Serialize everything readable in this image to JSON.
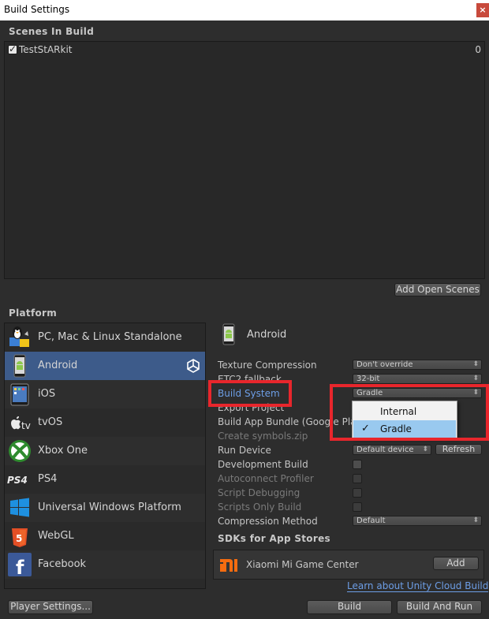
{
  "window": {
    "title": "Build Settings",
    "close": "×"
  },
  "scenes": {
    "header": "Scenes In Build",
    "items": [
      {
        "name": "TestStARkit",
        "index": "0",
        "checked": true
      }
    ],
    "add_open_scenes": "Add Open Scenes"
  },
  "platform": {
    "header": "Platform",
    "items": [
      {
        "label": "PC, Mac & Linux Standalone",
        "icon": "pc-mac-linux-icon"
      },
      {
        "label": "Android",
        "icon": "android-icon",
        "selected": true
      },
      {
        "label": "iOS",
        "icon": "ios-icon"
      },
      {
        "label": "tvOS",
        "icon": "tvos-icon"
      },
      {
        "label": "Xbox One",
        "icon": "xbox-icon"
      },
      {
        "label": "PS4",
        "icon": "ps4-icon"
      },
      {
        "label": "Universal Windows Platform",
        "icon": "windows-icon"
      },
      {
        "label": "WebGL",
        "icon": "html5-icon"
      },
      {
        "label": "Facebook",
        "icon": "facebook-icon"
      }
    ],
    "selected_title": "Android"
  },
  "settings": {
    "texture_compression": {
      "label": "Texture Compression",
      "value": "Don't override"
    },
    "etc2_fallback": {
      "label": "ETC2 fallback",
      "value": "32-bit"
    },
    "build_system": {
      "label": "Build System",
      "value": "Gradle"
    },
    "export_project": {
      "label": "Export Project"
    },
    "build_app_bundle": {
      "label": "Build App Bundle (Google Pla"
    },
    "create_symbols": {
      "label": "Create symbols.zip"
    },
    "run_device": {
      "label": "Run Device",
      "value": "Default device",
      "refresh": "Refresh"
    },
    "development_build": {
      "label": "Development Build"
    },
    "autoconnect_profiler": {
      "label": "Autoconnect Profiler"
    },
    "script_debugging": {
      "label": "Script Debugging"
    },
    "scripts_only_build": {
      "label": "Scripts Only Build"
    },
    "compression_method": {
      "label": "Compression Method",
      "value": "Default"
    }
  },
  "build_system_popup": {
    "options": [
      {
        "label": "Internal",
        "selected": false
      },
      {
        "label": "Gradle",
        "selected": true
      }
    ],
    "check": "✓"
  },
  "sdks": {
    "header": "SDKs for App Stores",
    "items": [
      {
        "name": "Xiaomi Mi Game Center",
        "add": "Add"
      }
    ],
    "link": "Learn about Unity Cloud Build"
  },
  "footer": {
    "player_settings": "Player Settings...",
    "build": "Build",
    "build_and_run": "Build And Run"
  },
  "colors": {
    "selection": "#3d5b8a",
    "highlight": "#e8262c",
    "link": "#6d9ee6"
  }
}
